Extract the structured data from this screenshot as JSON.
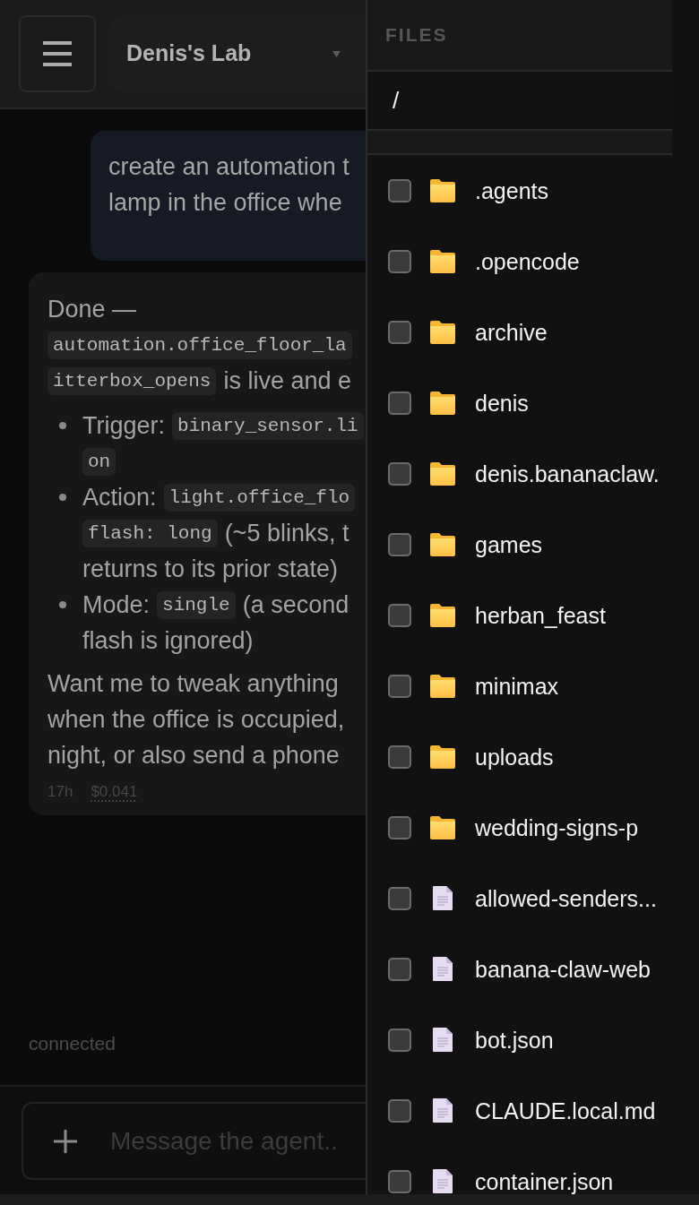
{
  "header": {
    "workspace": {
      "label": "Denis's Lab"
    }
  },
  "chat": {
    "messages": [
      {
        "kind": "user",
        "lines": [
          "create an automation t",
          "lamp in the office whe"
        ]
      },
      {
        "kind": "assistant",
        "blocks": [
          {
            "kind": "paragraph",
            "lines": [
              [
                {
                  "kind": "text",
                  "text": "Done —"
                }
              ],
              [
                {
                  "kind": "code",
                  "text": "automation.office_floor_la"
                }
              ],
              [
                {
                  "kind": "code",
                  "text": "itterbox_opens"
                },
                {
                  "kind": "text",
                  "text": "is live and e"
                }
              ]
            ]
          },
          {
            "kind": "list",
            "items": [
              {
                "lines": [
                  [
                    {
                      "kind": "text",
                      "text": "Trigger:"
                    },
                    {
                      "kind": "code",
                      "text": "binary_sensor.li"
                    }
                  ],
                  [
                    {
                      "kind": "code",
                      "text": "on"
                    }
                  ]
                ]
              },
              {
                "lines": [
                  [
                    {
                      "kind": "text",
                      "text": "Action:"
                    },
                    {
                      "kind": "code",
                      "text": "light.office_flo"
                    }
                  ],
                  [
                    {
                      "kind": "code",
                      "text": "flash: long"
                    },
                    {
                      "kind": "text",
                      "text": "(~5 blinks, t"
                    }
                  ],
                  [
                    {
                      "kind": "text",
                      "text": "returns to its prior state)"
                    }
                  ]
                ]
              },
              {
                "lines": [
                  [
                    {
                      "kind": "text",
                      "text": "Mode:"
                    },
                    {
                      "kind": "code",
                      "text": "single"
                    },
                    {
                      "kind": "text",
                      "text": "(a second"
                    }
                  ],
                  [
                    {
                      "kind": "text",
                      "text": "flash is ignored)"
                    }
                  ]
                ]
              }
            ]
          },
          {
            "kind": "paragraph",
            "lines": [
              [
                {
                  "kind": "text",
                  "text": "Want me to tweak anything"
                }
              ],
              [
                {
                  "kind": "text",
                  "text": "when the office is occupied,"
                }
              ],
              [
                {
                  "kind": "text",
                  "text": "night, or also send a phone"
                }
              ]
            ]
          }
        ],
        "meta": {
          "age": "17h",
          "cost": "$0.041"
        }
      }
    ],
    "status": "connected"
  },
  "composer": {
    "placeholder": "Message the agent.."
  },
  "files_panel": {
    "title": "FILES",
    "path": "/",
    "items": [
      {
        "name": ".agents",
        "kind": "folder",
        "checked": false
      },
      {
        "name": ".opencode",
        "kind": "folder",
        "checked": false
      },
      {
        "name": "archive",
        "kind": "folder",
        "checked": false
      },
      {
        "name": "denis",
        "kind": "folder",
        "checked": false
      },
      {
        "name": "denis.bananaclaw.",
        "kind": "folder",
        "checked": false
      },
      {
        "name": "games",
        "kind": "folder",
        "checked": false
      },
      {
        "name": "herban_feast",
        "kind": "folder",
        "checked": false
      },
      {
        "name": "minimax",
        "kind": "folder",
        "checked": false
      },
      {
        "name": "uploads",
        "kind": "folder",
        "checked": false
      },
      {
        "name": "wedding-signs-p",
        "kind": "folder",
        "checked": false
      },
      {
        "name": "allowed-senders...",
        "kind": "file",
        "checked": false
      },
      {
        "name": "banana-claw-web",
        "kind": "file",
        "checked": false
      },
      {
        "name": "bot.json",
        "kind": "file",
        "checked": false
      },
      {
        "name": "CLAUDE.local.md",
        "kind": "file",
        "checked": false
      },
      {
        "name": "container.json",
        "kind": "file",
        "checked": false
      }
    ]
  }
}
